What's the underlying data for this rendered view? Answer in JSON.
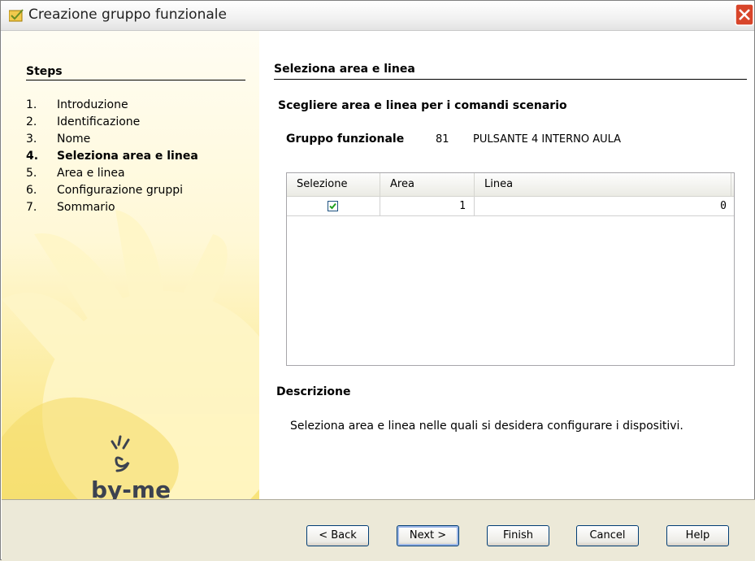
{
  "window": {
    "title": "Creazione gruppo funzionale"
  },
  "steps": {
    "title": "Steps",
    "items": [
      {
        "num": "1.",
        "label": "Introduzione",
        "active": false
      },
      {
        "num": "2.",
        "label": "Identificazione",
        "active": false
      },
      {
        "num": "3.",
        "label": "Nome",
        "active": false
      },
      {
        "num": "4.",
        "label": "Seleziona area e linea",
        "active": true
      },
      {
        "num": "5.",
        "label": "Area e linea",
        "active": false
      },
      {
        "num": "6.",
        "label": "Configurazione gruppi",
        "active": false
      },
      {
        "num": "7.",
        "label": "Sommario",
        "active": false
      }
    ]
  },
  "logo": {
    "text": "by-me"
  },
  "main": {
    "section_title": "Seleziona area e linea",
    "subtitle": "Scegliere area e linea per i comandi scenario",
    "group_label": "Gruppo funzionale",
    "group_number": "81",
    "group_name": "PULSANTE 4 INTERNO AULA",
    "table": {
      "columns": [
        "Selezione",
        "Area",
        "Linea"
      ],
      "rows": [
        {
          "selected": true,
          "area": "1",
          "linea": "0"
        }
      ]
    },
    "description_title": "Descrizione",
    "description_text": "Seleziona area e linea nelle quali si desidera configurare i dispositivi."
  },
  "buttons": {
    "back": "< Back",
    "next": "Next >",
    "finish": "Finish",
    "cancel": "Cancel",
    "help": "Help"
  },
  "colors": {
    "accent": "#f8e47a",
    "close": "#d8452a",
    "check": "#21a121"
  }
}
